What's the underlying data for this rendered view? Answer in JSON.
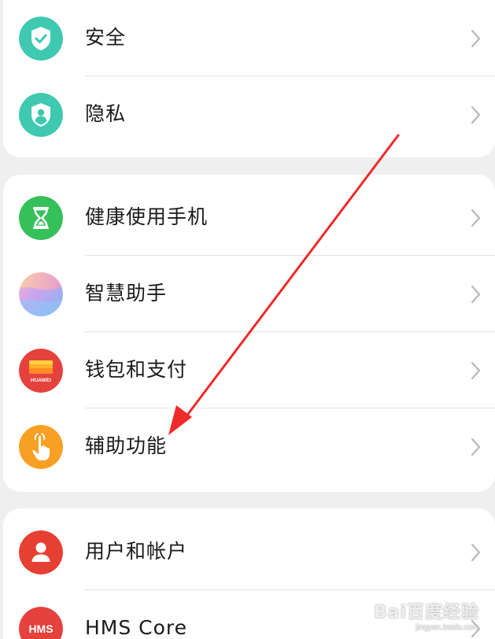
{
  "sections": [
    {
      "items": [
        {
          "label": "安全",
          "icon": "security-shield-check-icon",
          "color": "#3ec9b0"
        },
        {
          "label": "隐私",
          "icon": "privacy-shield-person-icon",
          "color": "#3ec9b0"
        }
      ]
    },
    {
      "items": [
        {
          "label": "健康使用手机",
          "icon": "hourglass-icon",
          "color": "#35c05a"
        },
        {
          "label": "智慧助手",
          "icon": "smart-assistant-orb-icon",
          "color": "#c99be8"
        },
        {
          "label": "钱包和支付",
          "icon": "huawei-wallet-icon",
          "color": "#e5413d",
          "icon_text": "HUAWEI"
        },
        {
          "label": "辅助功能",
          "icon": "accessibility-hand-icon",
          "color": "#f7a023"
        }
      ]
    },
    {
      "items": [
        {
          "label": "用户和帐户",
          "icon": "user-account-icon",
          "color": "#e64032"
        },
        {
          "label": "HMS Core",
          "icon": "hms-core-icon",
          "color": "#e5413d",
          "icon_text": "HMS"
        }
      ]
    }
  ],
  "annotation": {
    "color": "#ee2a2a"
  },
  "watermark": {
    "main": "Bai百度经验",
    "sub": "jingyan.baidu.com"
  }
}
